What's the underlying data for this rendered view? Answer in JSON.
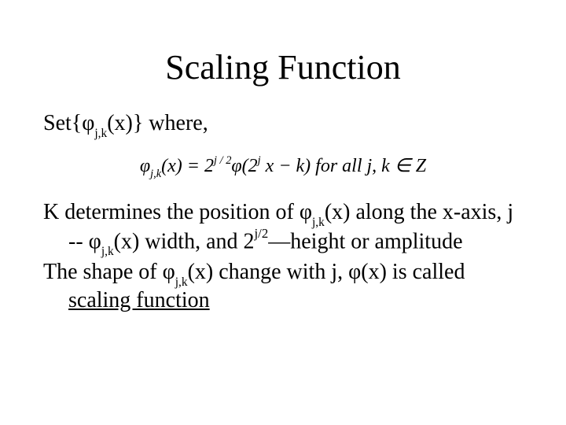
{
  "title": "Scaling Function",
  "set_line_parts": {
    "prefix": "Set{",
    "phi": "φ",
    "sub": "j,k",
    "mid": "(x)} where,"
  },
  "formula": {
    "lhs_phi": "φ",
    "lhs_sub": "j,k",
    "lhs_x": "(x) = 2",
    "exp1": "j / 2",
    "phi2": "φ",
    "open2": "(2",
    "exp2": "j",
    "tail": " x − k)  for all j, k ∈ Z"
  },
  "para1": {
    "t1": "K determines the position of ",
    "phi1": "φ",
    "sub1": "j,k",
    "t2": "(x)  along the x-axis, j -- ",
    "phi2": "φ",
    "sub2": "j,k",
    "t3": "(x) width, and 2",
    "sup1": "j/2",
    "t4": "—height or amplitude"
  },
  "para2": {
    "t1": "The shape of ",
    "phi1": "φ",
    "sub1": "j,k",
    "t2": "(x) change with j, ",
    "phi2": "φ",
    "t3": "(x) is called ",
    "u": "scaling function"
  }
}
